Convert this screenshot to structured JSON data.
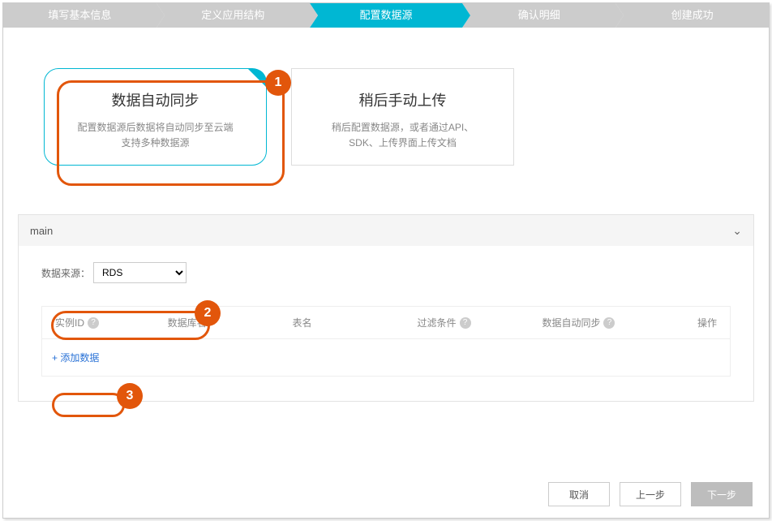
{
  "stepper": {
    "steps": [
      {
        "label": "填写基本信息",
        "active": false
      },
      {
        "label": "定义应用结构",
        "active": false
      },
      {
        "label": "配置数据源",
        "active": true
      },
      {
        "label": "确认明细",
        "active": false
      },
      {
        "label": "创建成功",
        "active": false
      }
    ]
  },
  "cards": {
    "auto": {
      "title": "数据自动同步",
      "desc1": "配置数据源后数据将自动同步至云端",
      "desc2": "支持多种数据源"
    },
    "later": {
      "title": "稍后手动上传",
      "desc1": "稍后配置数据源，或者通过API、",
      "desc2": "SDK、上传界面上传文档"
    }
  },
  "annotations": {
    "a1": "1",
    "a2": "2",
    "a3": "3"
  },
  "section": {
    "title": "main",
    "source_label": "数据来源：",
    "source_value": "RDS",
    "columns": {
      "instance": "实例ID",
      "db": "数据库名",
      "table": "表名",
      "filter": "过滤条件",
      "sync": "数据自动同步",
      "op": "操作"
    },
    "add_label": "+  添加数据"
  },
  "footer": {
    "cancel": "取消",
    "prev": "上一步",
    "next": "下一步"
  }
}
